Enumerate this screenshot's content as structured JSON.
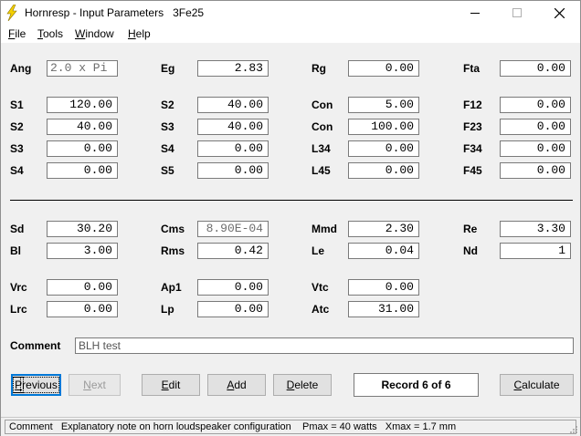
{
  "window": {
    "title": "Hornresp - Input Parameters   3Fe25",
    "controls": [
      "minimize",
      "maximize",
      "close"
    ]
  },
  "menu": [
    {
      "mnemonic": "F",
      "rest": "ile"
    },
    {
      "mnemonic": "T",
      "rest": "ools"
    },
    {
      "mnemonic": "W",
      "rest": "indow"
    },
    {
      "mnemonic": "H",
      "rest": "elp"
    }
  ],
  "params": {
    "Ang": {
      "label": "Ang",
      "value": "2.0 x Pi"
    },
    "Eg": {
      "label": "Eg",
      "value": "2.83"
    },
    "Rg": {
      "label": "Rg",
      "value": "0.00"
    },
    "Fta": {
      "label": "Fta",
      "value": "0.00"
    },
    "S1": {
      "label": "S1",
      "value": "120.00"
    },
    "S2a": {
      "label": "S2",
      "value": "40.00"
    },
    "Con1": {
      "label": "Con",
      "value": "5.00"
    },
    "F12": {
      "label": "F12",
      "value": "0.00"
    },
    "S2b": {
      "label": "S2",
      "value": "40.00"
    },
    "S3a": {
      "label": "S3",
      "value": "40.00"
    },
    "Con2": {
      "label": "Con",
      "value": "100.00"
    },
    "F23": {
      "label": "F23",
      "value": "0.00"
    },
    "S3b": {
      "label": "S3",
      "value": "0.00"
    },
    "S4a": {
      "label": "S4",
      "value": "0.00"
    },
    "L34": {
      "label": "L34",
      "value": "0.00"
    },
    "F34": {
      "label": "F34",
      "value": "0.00"
    },
    "S4b": {
      "label": "S4",
      "value": "0.00"
    },
    "S5": {
      "label": "S5",
      "value": "0.00"
    },
    "L45": {
      "label": "L45",
      "value": "0.00"
    },
    "F45": {
      "label": "F45",
      "value": "0.00"
    },
    "Sd": {
      "label": "Sd",
      "value": "30.20"
    },
    "Cms": {
      "label": "Cms",
      "value": "8.90E-04"
    },
    "Mmd": {
      "label": "Mmd",
      "value": "2.30"
    },
    "Re": {
      "label": "Re",
      "value": "3.30"
    },
    "Bl": {
      "label": "Bl",
      "value": "3.00"
    },
    "Rms": {
      "label": "Rms",
      "value": "0.42"
    },
    "Le": {
      "label": "Le",
      "value": "0.04"
    },
    "Nd": {
      "label": "Nd",
      "value": "1"
    },
    "Vrc": {
      "label": "Vrc",
      "value": "0.00"
    },
    "Ap1": {
      "label": "Ap1",
      "value": "0.00"
    },
    "Vtc": {
      "label": "Vtc",
      "value": "0.00"
    },
    "Lrc": {
      "label": "Lrc",
      "value": "0.00"
    },
    "Lp": {
      "label": "Lp",
      "value": "0.00"
    },
    "Atc": {
      "label": "Atc",
      "value": "31.00"
    }
  },
  "comment": {
    "label": "Comment",
    "value": "BLH test"
  },
  "buttons": {
    "previous": {
      "mnemonic": "P",
      "rest": "revious"
    },
    "next": {
      "mnemonic": "N",
      "rest": "ext"
    },
    "edit": {
      "mnemonic": "E",
      "rest": "dit"
    },
    "add": {
      "mnemonic": "A",
      "rest": "dd"
    },
    "delete": {
      "mnemonic": "D",
      "rest": "elete"
    },
    "calculate": {
      "mnemonic": "C",
      "rest": "alculate"
    }
  },
  "record": "Record 6 of 6",
  "status": "Comment   Explanatory note on horn loudspeaker configuration    Pmax = 40 watts   Xmax = 1.7 mm",
  "colors": {
    "accent": "#0078d7",
    "icon_yellow": "#f5d000"
  }
}
